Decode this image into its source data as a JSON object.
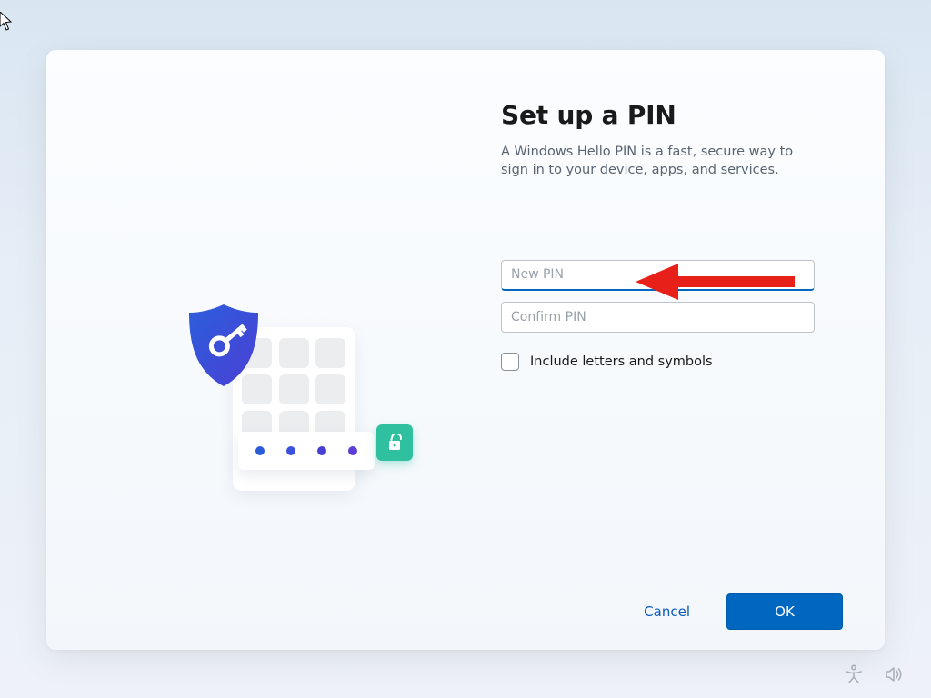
{
  "dialog": {
    "title": "Set up a PIN",
    "subtitle": "A Windows Hello PIN is a fast, secure way to sign in to your device, apps, and services.",
    "new_pin_placeholder": "New PIN",
    "confirm_pin_placeholder": "Confirm PIN",
    "include_checkbox_label": "Include letters and symbols",
    "cancel_label": "Cancel",
    "ok_label": "OK"
  },
  "colors": {
    "accent": "#0067c0",
    "shield_start": "#2c5edb",
    "shield_end": "#4b3fd5",
    "unlock_badge": "#2fc0a0",
    "arrow": "#e8201a"
  }
}
